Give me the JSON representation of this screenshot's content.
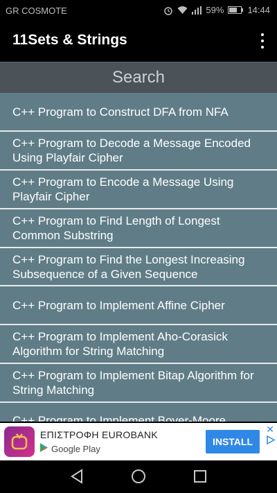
{
  "status": {
    "carrier": "GR COSMOTE",
    "battery": "59%",
    "time": "14:44",
    "icons": [
      "alarm-icon",
      "wifi-icon",
      "signal-icon",
      "battery-icon"
    ]
  },
  "app_bar": {
    "title": "11Sets & Strings"
  },
  "search": {
    "placeholder": "Search"
  },
  "list": [
    "C++ Program to Construct DFA from NFA",
    "C++ Program to Decode a Message Encoded Using Playfair Cipher",
    "C++ Program to Encode a Message Using Playfair Cipher",
    "C++ Program to Find Length of Longest Common Substring",
    "C++ Program to Find the Longest Increasing Subsequence of a Given Sequence",
    "C++ Program to Implement Affine Cipher",
    "C++ Program to Implement Aho-Corasick Algorithm for String Matching",
    "C++ Program to Implement Bitap Algorithm for String Matching",
    "C++ Program to Implement Boyer-Moore"
  ],
  "ad": {
    "title": "ΕΠΙΣΤΡΟΦΗ EUROBANK",
    "store": "Google Play",
    "button": "INSTALL"
  },
  "colors": {
    "list_item_bg": "#607d87",
    "search_bg": "#4b5358",
    "install_blue": "#2f88e6"
  }
}
